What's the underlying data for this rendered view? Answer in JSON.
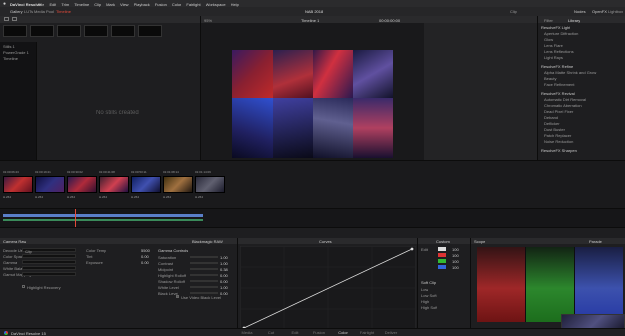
{
  "menu": {
    "app": "DaVinci Resolve",
    "items": [
      "File",
      "Edit",
      "Trim",
      "Timeline",
      "Clip",
      "Mark",
      "View",
      "Playback",
      "Fusion",
      "Color",
      "Fairlight",
      "Workspace",
      "Help"
    ]
  },
  "top_toolbar": {
    "gallery": "Gallery",
    "luts": "LUTs",
    "media_pool": "Media Pool",
    "timeline_btn": "Timeline",
    "project_name": "NAB 2018",
    "timeline_name": "Timeline 1",
    "zoom": "95%",
    "timecode": "00:00:00:00",
    "clip_label": "Clip",
    "nodes": "Nodes",
    "openfx": "OpenFX",
    "lightbox": "Lightbox"
  },
  "gallery": {
    "empty_text": "No stills created",
    "albums": [
      "Stills 1",
      "PowerGrade 1",
      "Timeline"
    ]
  },
  "viewer": {
    "timecode": "01:01:02:08"
  },
  "openfx": {
    "tabs": [
      "Filter",
      "Library"
    ],
    "sections": [
      {
        "title": "ResolveFX Light",
        "items": [
          "Aperture Diffraction",
          "Glow",
          "Lens Flare",
          "Lens Reflections",
          "Light Rays"
        ]
      },
      {
        "title": "ResolveFX Refine",
        "items": [
          "Alpha Matte Shrink and Grow",
          "Beauty",
          "Face Refinement"
        ]
      },
      {
        "title": "ResolveFX Revival",
        "items": [
          "Automatic Dirt Removal",
          "Chromatic Aberration",
          "Dead Pixel Fixer",
          "Deband",
          "Deflicker",
          "Dust Buster",
          "Patch Replacer",
          "Noise Reduction"
        ]
      },
      {
        "title": "ResolveFX Sharpen",
        "items": []
      }
    ]
  },
  "clips": [
    {
      "id": "01",
      "tc": "01:00:06:23",
      "codec": "H.264"
    },
    {
      "id": "02",
      "tc": "01:00:19:21",
      "codec": "H.264"
    },
    {
      "id": "03",
      "tc": "01:00:30:02",
      "codec": "H.264"
    },
    {
      "id": "04",
      "tc": "01:00:41:08",
      "codec": "H.264"
    },
    {
      "id": "05",
      "tc": "01:00:53:11",
      "codec": "H.264"
    },
    {
      "id": "06",
      "tc": "01:01:08:14",
      "codec": "H.264"
    },
    {
      "id": "07",
      "tc": "01:01:14:09",
      "codec": "H.264"
    }
  ],
  "color": {
    "camera_raw_title": "Camera Raw",
    "decode_using": "Decode Using",
    "decode_value": "Clip",
    "color_space": "Color Space",
    "gamma": "Gamma",
    "white_balance": "White Balance",
    "color_temp": "Color Temp",
    "tint": "Tint",
    "exposure": "Exposure",
    "color_temp_val": "5500",
    "tint_val": "0.00",
    "exposure_val": "0.00",
    "gamut_label": "Gamut Mapping",
    "highlight_recovery": "Highlight Recovery",
    "blackmagic_raw": "Blackmagic RAW",
    "gamma_controls": "Gamma Controls",
    "gamma_rows": [
      {
        "label": "Saturation",
        "val": "1.00"
      },
      {
        "label": "Contrast",
        "val": "1.00"
      },
      {
        "label": "Midpoint",
        "val": "0.38"
      },
      {
        "label": "Highlight Rolloff",
        "val": "0.00"
      },
      {
        "label": "Shadow Rolloff",
        "val": "0.00"
      },
      {
        "label": "White Level",
        "val": "1.00"
      },
      {
        "label": "Black Level",
        "val": "0.00"
      }
    ],
    "use_video_black": "Use Video Black Level",
    "curves_title": "Curves",
    "custom_title": "Custom",
    "edit_label": "Edit",
    "soft_clip": "Soft Clip",
    "soft_rows": [
      "Low",
      "Low Soft",
      "High",
      "High Soft"
    ],
    "curve_vals": [
      "100",
      "100",
      "100",
      "100"
    ],
    "scope_title": "Scope",
    "scope_mode": "Parade"
  },
  "bottom_bar": {
    "app": "DaVinci Resolve 15",
    "pages": [
      "Media",
      "Cut",
      "Edit",
      "Fusion",
      "Color",
      "Fairlight",
      "Deliver"
    ],
    "active_page": "Color"
  },
  "colors": {
    "accent": "#e34a3a",
    "active_tab": "#d0d0d0",
    "node_border": "#7a9fd8"
  }
}
